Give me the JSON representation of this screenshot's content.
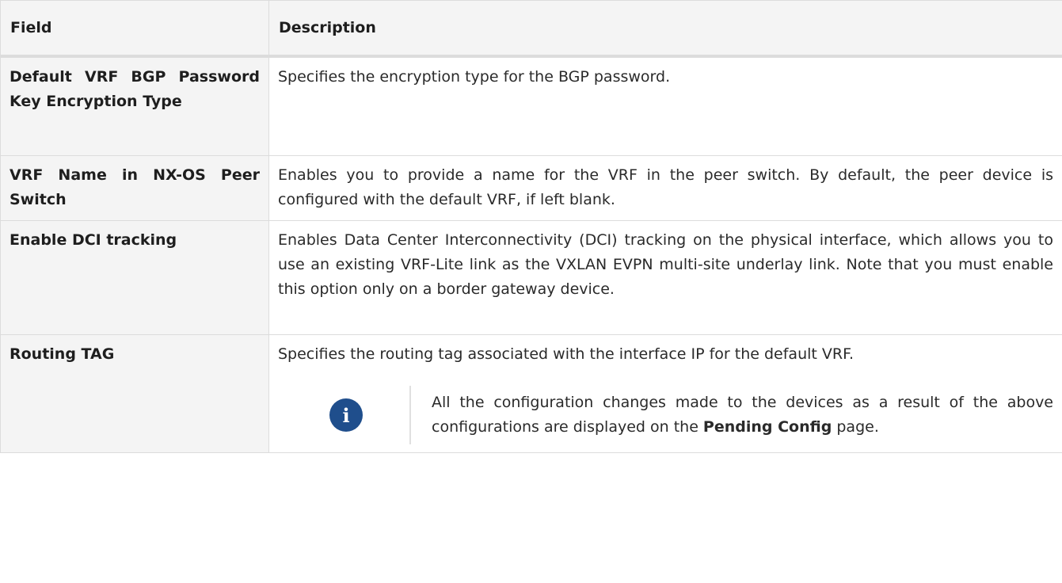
{
  "table": {
    "headers": {
      "field": "Field",
      "description": "Description"
    },
    "rows": [
      {
        "field": "Default VRF BGP Password Key Encryption Type",
        "description": "Specifies the encryption type for the BGP password."
      },
      {
        "field": "VRF Name in NX-OS Peer Switch",
        "description": "Enables you to provide a name for the VRF in the peer switch. By default, the peer device is configured with the default VRF, if left blank."
      },
      {
        "field": "Enable DCI tracking",
        "description": "Enables Data Center Interconnectivity (DCI) tracking on the physical interface, which allows you to use an existing VRF-Lite link as the VXLAN EVPN multi-site underlay link. Note that you must enable this option only on a border gateway device."
      },
      {
        "field": "Routing TAG",
        "description": "Specifies the routing tag associated with the interface IP for the default VRF."
      }
    ]
  },
  "note": {
    "icon": "info-icon",
    "text_before": "All the configuration changes made to the devices as a result of the above configurations are displayed on the ",
    "text_bold": "Pending Config",
    "text_after": " page.",
    "icon_color": "#1f4e8c"
  }
}
